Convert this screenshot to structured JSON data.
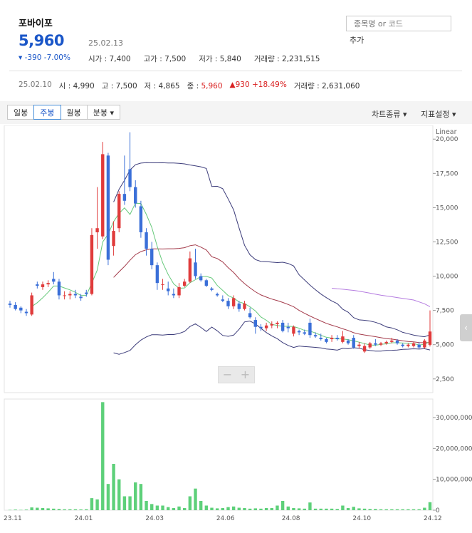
{
  "stock": {
    "name": "포바이포",
    "price": "5,960",
    "date": "25.02.13",
    "change": "▾ -390  -7.00%",
    "open_label": "시가 : ",
    "open": "7,400",
    "high_label": "고가 : ",
    "high": "7,500",
    "low_label": "저가 : ",
    "low": "5,840",
    "vol_label": "거래량 : ",
    "volume": "2,231,515"
  },
  "search": {
    "placeholder": "종목명 or 코드",
    "add_label": "추가"
  },
  "week": {
    "date": "25.02.10",
    "open_label": "시 : ",
    "open": "4,990",
    "high_label": "고 : ",
    "high": "7,500",
    "low_label": "저 : ",
    "low": "4,865",
    "close_label": "종 : ",
    "close": "5,960",
    "change": "▲930  +18.49%",
    "vol_label": "거래량 : ",
    "volume": "2,631,060"
  },
  "toolbar": {
    "tabs": [
      "일봉",
      "주봉",
      "월봉",
      "분봉 ▾"
    ],
    "active_tab": 1,
    "chart_type": "차트종류 ▾",
    "indicator": "지표설정 ▾"
  },
  "chart_data": {
    "type": "candlestick",
    "scale_label": "Linear",
    "price_ticks": [
      2500,
      5000,
      7500,
      10000,
      12500,
      15000,
      17500,
      20000
    ],
    "volume_ticks": [
      0,
      10000000,
      20000000,
      30000000
    ],
    "x_labels": [
      "23.11",
      "24.01",
      "24.03",
      "24.06",
      "24.08",
      "24.10",
      "24.12"
    ],
    "candles": [
      [
        8000,
        8200,
        7700,
        7900
      ],
      [
        7900,
        8100,
        7500,
        7600
      ],
      [
        7700,
        7800,
        7300,
        7500
      ],
      [
        7400,
        7600,
        7100,
        7300
      ],
      [
        7200,
        8800,
        7100,
        8600
      ],
      [
        9400,
        9600,
        9100,
        9300
      ],
      [
        9200,
        9600,
        9000,
        9400
      ],
      [
        9400,
        9700,
        9200,
        9500
      ],
      [
        9800,
        10300,
        9400,
        9600
      ],
      [
        9600,
        9800,
        8300,
        8600
      ],
      [
        8600,
        8900,
        8300,
        8600
      ],
      [
        8600,
        8900,
        8300,
        8700
      ],
      [
        8700,
        9000,
        8400,
        8600
      ],
      [
        8500,
        8700,
        8200,
        8400
      ],
      [
        8800,
        9000,
        8500,
        8700
      ],
      [
        8700,
        13500,
        8600,
        13000
      ],
      [
        13200,
        16500,
        12000,
        13500
      ],
      [
        12900,
        19800,
        12700,
        18900
      ],
      [
        18800,
        19000,
        10800,
        11200
      ],
      [
        12200,
        14000,
        11500,
        13300
      ],
      [
        13500,
        16200,
        13200,
        16000
      ],
      [
        16000,
        18800,
        15200,
        15500
      ],
      [
        17800,
        20500,
        16200,
        16500
      ],
      [
        16500,
        17000,
        15000,
        15300
      ],
      [
        15100,
        15500,
        12800,
        13200
      ],
      [
        13200,
        13500,
        11500,
        12000
      ],
      [
        12000,
        12500,
        10500,
        10800
      ],
      [
        10800,
        11000,
        9000,
        9500
      ],
      [
        9400,
        9800,
        9000,
        9400
      ],
      [
        9100,
        9600,
        8600,
        8900
      ],
      [
        8700,
        9100,
        8400,
        8600
      ],
      [
        8600,
        9500,
        8400,
        9200
      ],
      [
        9300,
        9800,
        9200,
        9600
      ],
      [
        9600,
        11800,
        9500,
        11300
      ],
      [
        11000,
        12000,
        9800,
        10000
      ],
      [
        10000,
        10200,
        9600,
        9700
      ],
      [
        9700,
        9800,
        9200,
        9300
      ],
      [
        9100,
        9200,
        8900,
        9000
      ],
      [
        8700,
        8800,
        8500,
        8600
      ],
      [
        8300,
        8600,
        8100,
        8200
      ],
      [
        8200,
        8400,
        7600,
        7800
      ],
      [
        7800,
        8600,
        7600,
        8400
      ],
      [
        8000,
        8200,
        7400,
        7600
      ],
      [
        7600,
        8200,
        7500,
        8000
      ],
      [
        7300,
        7700,
        6900,
        7000
      ],
      [
        6800,
        7000,
        5800,
        6300
      ],
      [
        6300,
        6500,
        6000,
        6200
      ],
      [
        6200,
        6600,
        6000,
        6400
      ],
      [
        6400,
        6700,
        6200,
        6500
      ],
      [
        6500,
        6700,
        6200,
        6600
      ],
      [
        6600,
        6800,
        5900,
        6000
      ],
      [
        6300,
        6600,
        5900,
        6200
      ],
      [
        5800,
        6400,
        5600,
        6300
      ],
      [
        6000,
        6100,
        5700,
        5900
      ],
      [
        5900,
        6100,
        5700,
        5800
      ],
      [
        6600,
        6900,
        5500,
        5700
      ],
      [
        5700,
        5900,
        5500,
        5600
      ],
      [
        5500,
        5800,
        5300,
        5400
      ],
      [
        5400,
        5500,
        5100,
        5200
      ],
      [
        5400,
        5700,
        5200,
        5500
      ],
      [
        5500,
        5700,
        5300,
        5400
      ],
      [
        5200,
        6000,
        5100,
        5600
      ],
      [
        5300,
        5400,
        5000,
        5100
      ],
      [
        5500,
        5700,
        4700,
        4800
      ],
      [
        4900,
        5200,
        4700,
        5000
      ],
      [
        4500,
        5100,
        4400,
        4900
      ],
      [
        4800,
        5200,
        4700,
        5100
      ],
      [
        5100,
        5400,
        4900,
        5000
      ],
      [
        5000,
        5200,
        4900,
        5100
      ],
      [
        5100,
        5300,
        5000,
        5200
      ],
      [
        5200,
        5500,
        5100,
        5300
      ],
      [
        5300,
        5400,
        5000,
        5100
      ],
      [
        5000,
        5100,
        4800,
        4900
      ],
      [
        4900,
        5100,
        4800,
        5000
      ],
      [
        4900,
        5200,
        4800,
        5100
      ],
      [
        5000,
        5200,
        4700,
        4800
      ],
      [
        4800,
        5400,
        4700,
        5300
      ],
      [
        4990,
        7500,
        4865,
        5960
      ]
    ],
    "volumes": [
      100,
      200,
      100,
      200,
      900,
      800,
      700,
      600,
      500,
      400,
      300,
      300,
      300,
      250,
      300,
      3900,
      3500,
      35000,
      8500,
      15000,
      10000,
      4500,
      4500,
      9000,
      8500,
      3000,
      2000,
      1500,
      1500,
      1000,
      700,
      1200,
      700,
      4500,
      7000,
      3000,
      1500,
      800,
      600,
      700,
      1000,
      1200,
      800,
      700,
      500,
      600,
      500,
      700,
      700,
      1500,
      3000,
      1200,
      700,
      600,
      500,
      2500,
      500,
      500,
      500,
      500,
      400,
      1500,
      700,
      1100,
      600,
      500,
      400,
      400,
      300,
      300,
      300,
      300,
      300,
      300,
      300,
      300,
      800,
      2600
    ],
    "colors": {
      "up": "#e03b3b",
      "down": "#3a6fd8",
      "volume": "#5ed07a",
      "ma5": "#67c97b",
      "ma20": "#a33a4a",
      "ma60": "#b57ce0",
      "ma120": "#f0a05a",
      "band": "#3c3c7a"
    }
  }
}
